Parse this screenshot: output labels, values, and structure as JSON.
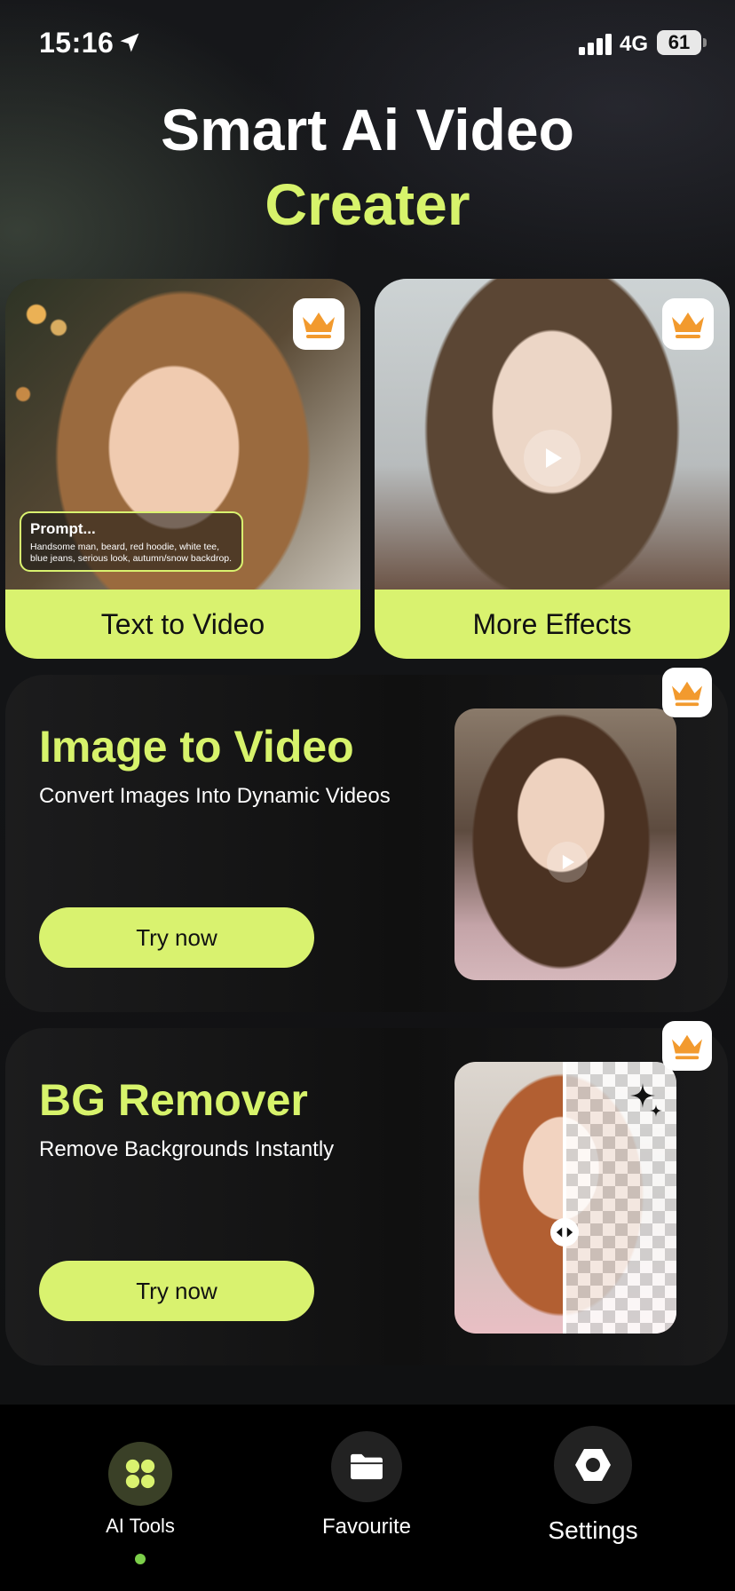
{
  "colors": {
    "accent": "#d7f36b",
    "card_label_bg": "#d9f26f",
    "crown": "#f29a2e",
    "background": "#111214"
  },
  "status_bar": {
    "time": "15:16",
    "network": "4G",
    "battery": "61",
    "icons": [
      "location-arrow-icon",
      "signal-bars-icon",
      "battery-icon"
    ]
  },
  "header": {
    "title_line1": "Smart Ai Video",
    "title_line2": "Creater"
  },
  "top_cards": [
    {
      "label": "Text to Video",
      "badge_icon": "crown-icon",
      "prompt": {
        "title": "Prompt...",
        "text": "Handsome man, beard, red hoodie, white tee, blue jeans, serious look, autumn/snow backdrop."
      }
    },
    {
      "label": "More Effects",
      "badge_icon": "crown-icon",
      "overlay_icon": "play-icon"
    }
  ],
  "features": [
    {
      "title": "Image to Video",
      "subtitle": "Convert Images Into Dynamic Videos",
      "button": "Try now",
      "badge_icon": "crown-icon",
      "overlay_icon": "play-icon"
    },
    {
      "title": "BG Remover",
      "subtitle": "Remove Backgrounds Instantly",
      "button": "Try now",
      "badge_icon": "crown-icon",
      "overlay_icon": "sparkle-icon"
    }
  ],
  "bottom_nav": {
    "items": [
      {
        "label": "AI Tools",
        "icon": "grid-dots-icon",
        "active": true
      },
      {
        "label": "Favourite",
        "icon": "folder-icon",
        "active": false
      },
      {
        "label": "Settings",
        "icon": "hexagon-gear-icon",
        "active": false
      }
    ]
  }
}
